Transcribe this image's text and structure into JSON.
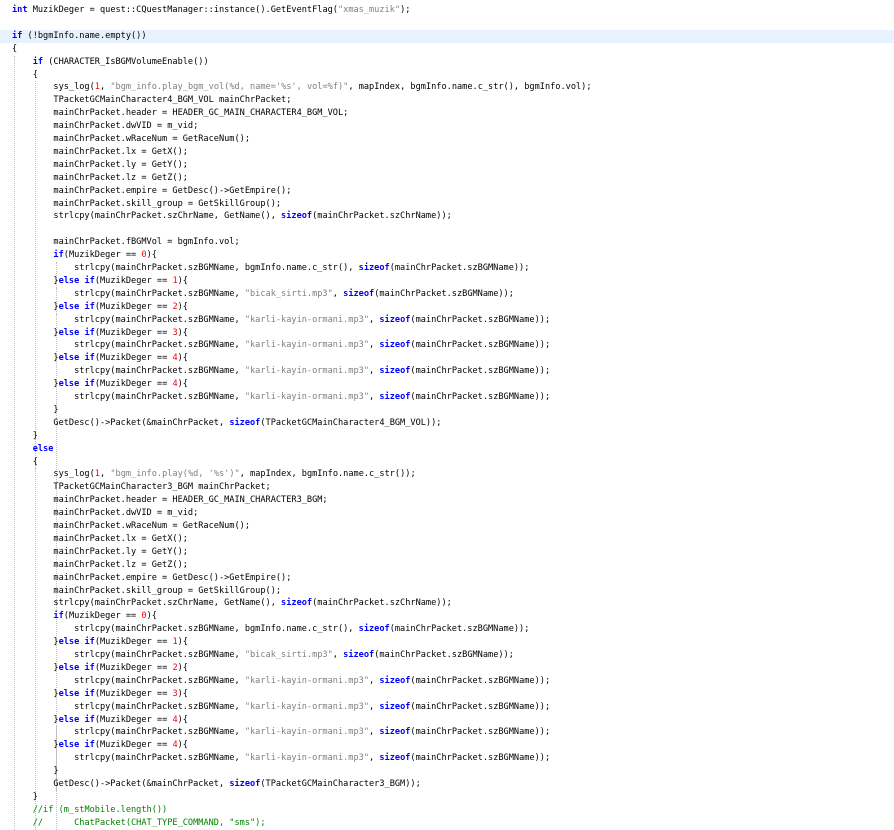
{
  "editor": {
    "language": "cpp",
    "highlighted_line": 2,
    "colors": {
      "background": "#ffffff",
      "current_line": "#e8f2fe",
      "keyword": "#0000ff",
      "number": "#ff0000",
      "string": "#808080",
      "comment": "#008000",
      "text": "#000000"
    },
    "lines": [
      "int MuzikDeger = quest::CQuestManager::instance().GetEventFlag(\"xmas_muzik\");",
      "",
      "if (!bgmInfo.name.empty())",
      "{",
      "    if (CHARACTER_IsBGMVolumeEnable())",
      "    {",
      "        sys_log(1, \"bgm_info.play_bgm_vol(%d, name='%s', vol=%f)\", mapIndex, bgmInfo.name.c_str(), bgmInfo.vol);",
      "        TPacketGCMainCharacter4_BGM_VOL mainChrPacket;",
      "        mainChrPacket.header = HEADER_GC_MAIN_CHARACTER4_BGM_VOL;",
      "        mainChrPacket.dwVID = m_vid;",
      "        mainChrPacket.wRaceNum = GetRaceNum();",
      "        mainChrPacket.lx = GetX();",
      "        mainChrPacket.ly = GetY();",
      "        mainChrPacket.lz = GetZ();",
      "        mainChrPacket.empire = GetDesc()->GetEmpire();",
      "        mainChrPacket.skill_group = GetSkillGroup();",
      "        strlcpy(mainChrPacket.szChrName, GetName(), sizeof(mainChrPacket.szChrName));",
      "",
      "        mainChrPacket.fBGMVol = bgmInfo.vol;",
      "        if(MuzikDeger == 0){",
      "            strlcpy(mainChrPacket.szBGMName, bgmInfo.name.c_str(), sizeof(mainChrPacket.szBGMName));",
      "        }else if(MuzikDeger == 1){",
      "            strlcpy(mainChrPacket.szBGMName, \"bicak_sirti.mp3\", sizeof(mainChrPacket.szBGMName));",
      "        }else if(MuzikDeger == 2){",
      "            strlcpy(mainChrPacket.szBGMName, \"karli-kayin-ormani.mp3\", sizeof(mainChrPacket.szBGMName));",
      "        }else if(MuzikDeger == 3){",
      "            strlcpy(mainChrPacket.szBGMName, \"karli-kayin-ormani.mp3\", sizeof(mainChrPacket.szBGMName));",
      "        }else if(MuzikDeger == 4){",
      "            strlcpy(mainChrPacket.szBGMName, \"karli-kayin-ormani.mp3\", sizeof(mainChrPacket.szBGMName));",
      "        }else if(MuzikDeger == 4){",
      "            strlcpy(mainChrPacket.szBGMName, \"karli-kayin-ormani.mp3\", sizeof(mainChrPacket.szBGMName));",
      "        }",
      "        GetDesc()->Packet(&mainChrPacket, sizeof(TPacketGCMainCharacter4_BGM_VOL));",
      "    }",
      "    else",
      "    {",
      "        sys_log(1, \"bgm_info.play(%d, '%s')\", mapIndex, bgmInfo.name.c_str());",
      "        TPacketGCMainCharacter3_BGM mainChrPacket;",
      "        mainChrPacket.header = HEADER_GC_MAIN_CHARACTER3_BGM;",
      "        mainChrPacket.dwVID = m_vid;",
      "        mainChrPacket.wRaceNum = GetRaceNum();",
      "        mainChrPacket.lx = GetX();",
      "        mainChrPacket.ly = GetY();",
      "        mainChrPacket.lz = GetZ();",
      "        mainChrPacket.empire = GetDesc()->GetEmpire();",
      "        mainChrPacket.skill_group = GetSkillGroup();",
      "        strlcpy(mainChrPacket.szChrName, GetName(), sizeof(mainChrPacket.szChrName));",
      "        if(MuzikDeger == 0){",
      "            strlcpy(mainChrPacket.szBGMName, bgmInfo.name.c_str(), sizeof(mainChrPacket.szBGMName));",
      "        }else if(MuzikDeger == 1){",
      "            strlcpy(mainChrPacket.szBGMName, \"bicak_sirti.mp3\", sizeof(mainChrPacket.szBGMName));",
      "        }else if(MuzikDeger == 2){",
      "            strlcpy(mainChrPacket.szBGMName, \"karli-kayin-ormani.mp3\", sizeof(mainChrPacket.szBGMName));",
      "        }else if(MuzikDeger == 3){",
      "            strlcpy(mainChrPacket.szBGMName, \"karli-kayin-ormani.mp3\", sizeof(mainChrPacket.szBGMName));",
      "        }else if(MuzikDeger == 4){",
      "            strlcpy(mainChrPacket.szBGMName, \"karli-kayin-ormani.mp3\", sizeof(mainChrPacket.szBGMName));",
      "        }else if(MuzikDeger == 4){",
      "            strlcpy(mainChrPacket.szBGMName, \"karli-kayin-ormani.mp3\", sizeof(mainChrPacket.szBGMName));",
      "        }",
      "        GetDesc()->Packet(&mainChrPacket, sizeof(TPacketGCMainCharacter3_BGM));",
      "    }",
      "    //if (m_stMobile.length())",
      "    //      ChatPacket(CHAT_TYPE_COMMAND, \"sms\");"
    ]
  }
}
